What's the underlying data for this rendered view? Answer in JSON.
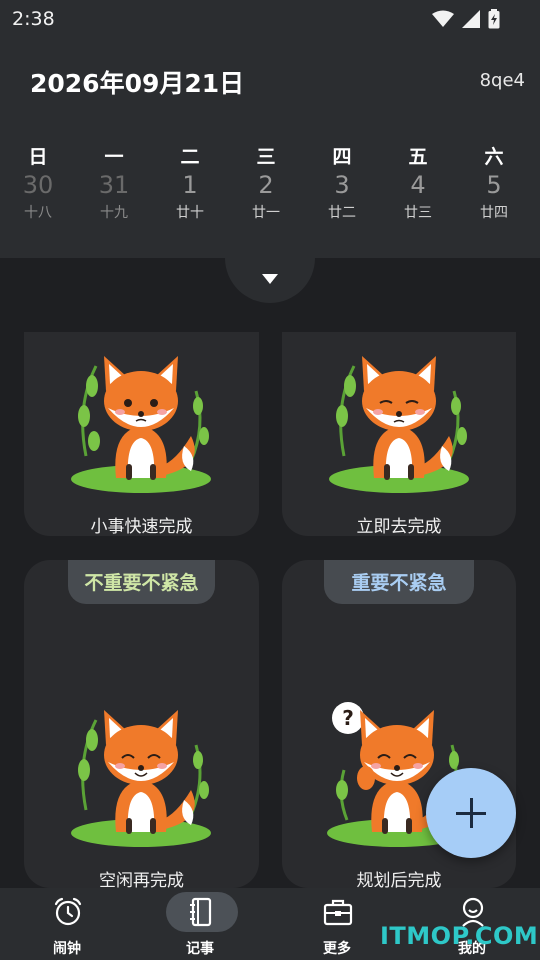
{
  "status": {
    "time": "2:38"
  },
  "header": {
    "date_title": "2026年09月21日",
    "date_code": "8qe4"
  },
  "week": [
    {
      "weekday": "日",
      "day": "30",
      "lunar": "十八",
      "dim": true
    },
    {
      "weekday": "一",
      "day": "31",
      "lunar": "十九",
      "dim": true
    },
    {
      "weekday": "二",
      "day": "1",
      "lunar": "廿十",
      "dim": false
    },
    {
      "weekday": "三",
      "day": "2",
      "lunar": "廿一",
      "dim": false
    },
    {
      "weekday": "四",
      "day": "3",
      "lunar": "廿二",
      "dim": false
    },
    {
      "weekday": "五",
      "day": "4",
      "lunar": "廿三",
      "dim": false
    },
    {
      "weekday": "六",
      "day": "5",
      "lunar": "廿四",
      "dim": false
    }
  ],
  "cards": [
    {
      "label": "小事快速完成",
      "tag": ""
    },
    {
      "label": "立即去完成",
      "tag": ""
    },
    {
      "label": "空闲再完成",
      "tag": "不重要不紧急",
      "tag_color": "#cfe6a6"
    },
    {
      "label": "规划后完成",
      "tag": "重要不紧急",
      "tag_color": "#a9cdf2"
    }
  ],
  "nav": [
    {
      "label": "闹钟",
      "icon": "alarm-clock-icon",
      "active": false
    },
    {
      "label": "记事",
      "icon": "notebook-icon",
      "active": true
    },
    {
      "label": "更多",
      "icon": "toolbox-icon",
      "active": false
    },
    {
      "label": "我的",
      "icon": "profile-icon",
      "active": false
    }
  ],
  "fab": {
    "icon": "plus-icon"
  },
  "watermark": "ITMOP.COM",
  "colors": {
    "background": "#1e1f22",
    "surface": "#2b2d30",
    "card": "#2a2b2e",
    "fab": "#a6cdf7",
    "fox_orange": "#f07a2a",
    "leaf_green": "#6fbf3f"
  }
}
